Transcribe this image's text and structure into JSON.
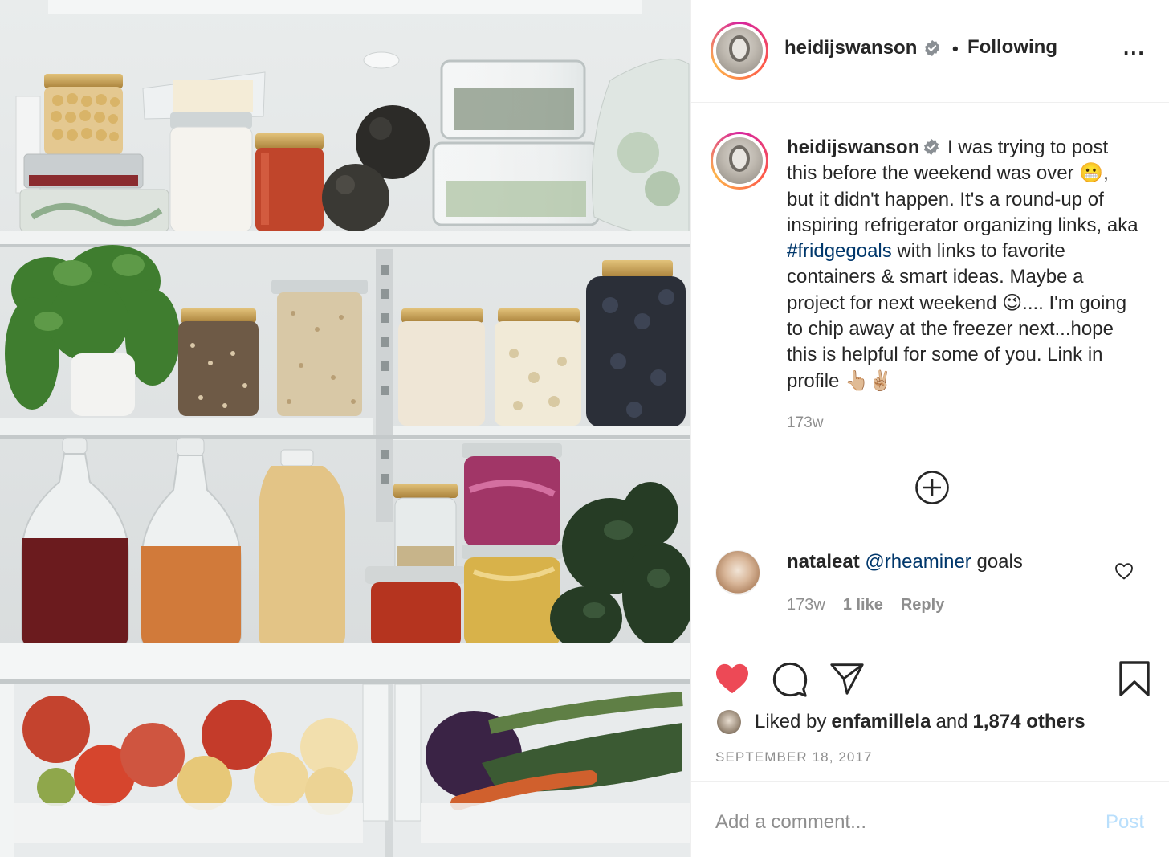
{
  "post": {
    "image_alt": "Open refrigerator with glass jars, greens and produce drawers"
  },
  "header": {
    "username": "heidijswanson",
    "separator": "•",
    "follow_status": "Following",
    "more_label": "..."
  },
  "caption": {
    "username": "heidijswanson",
    "text_before": "I was trying to post this before the weekend was over 😬, but it didn't happen. It's a round-up of inspiring refrigerator organizing links, aka ",
    "hashtag": "#fridgegoals",
    "text_after": " with links to favorite containers & smart ideas. Maybe a project for next weekend 😉.... I'm going to chip away at the freezer next...hope this is helpful for some of you. Link in profile 👆🏼✌🏼",
    "time": "173w"
  },
  "comment": {
    "username": "nataleat",
    "mention": "@rheaminer",
    "text": " goals",
    "time": "173w",
    "likes": "1 like",
    "reply_label": "Reply"
  },
  "likes": {
    "prefix": "Liked by",
    "liker": "enfamillela",
    "conjunction": "and",
    "others": "1,874 others"
  },
  "date": "SEPTEMBER 18, 2017",
  "add_comment": {
    "placeholder": "Add a comment...",
    "post_label": "Post"
  },
  "colors": {
    "like_red": "#ed4956",
    "link_blue": "#00376b",
    "verified_blue": "#3897f0",
    "post_disabled": "#b9dffc",
    "meta_gray": "#8e8e8e"
  },
  "icons": {
    "header": [
      "verified-badge-icon",
      "more-options-icon"
    ],
    "actions": [
      "heart-filled-icon",
      "comment-bubble-icon",
      "share-paper-plane-icon",
      "bookmark-icon"
    ],
    "misc": [
      "load-more-plus-icon",
      "comment-heart-outline-icon"
    ]
  }
}
